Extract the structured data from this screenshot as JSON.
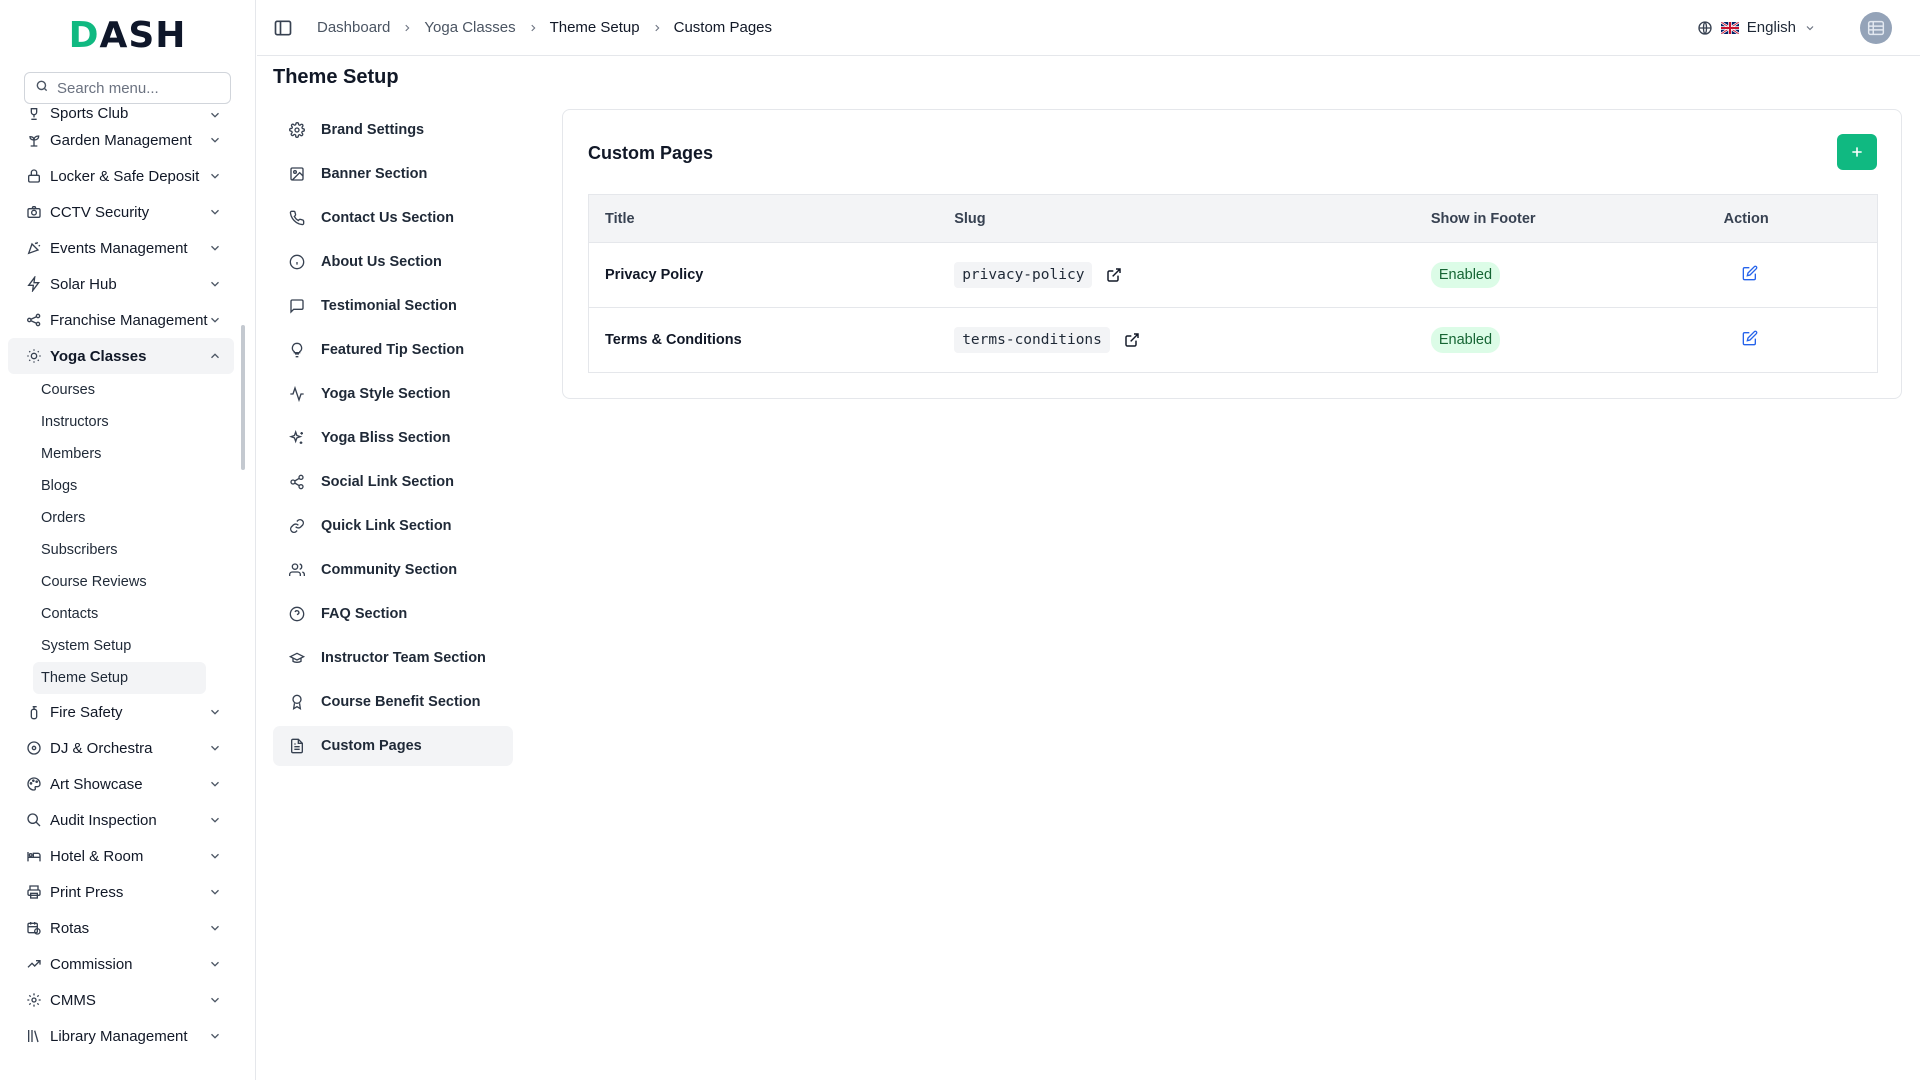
{
  "brand": {
    "logo_main": "ASH",
    "logo_accent": "D"
  },
  "search": {
    "placeholder": "Search menu..."
  },
  "sidebar": {
    "items": [
      {
        "label": "Sports Club",
        "icon": "trophy-icon"
      },
      {
        "label": "Garden Management",
        "icon": "plant-icon"
      },
      {
        "label": "Locker & Safe Deposit",
        "icon": "lock-icon"
      },
      {
        "label": "CCTV Security",
        "icon": "camera-icon"
      },
      {
        "label": "Events Management",
        "icon": "party-icon"
      },
      {
        "label": "Solar Hub",
        "icon": "bolt-icon"
      },
      {
        "label": "Franchise Management",
        "icon": "network-icon"
      },
      {
        "label": "Yoga Classes",
        "icon": "sun-icon"
      }
    ],
    "yoga_sub": [
      "Courses",
      "Instructors",
      "Members",
      "Blogs",
      "Orders",
      "Subscribers",
      "Course Reviews",
      "Contacts",
      "System Setup",
      "Theme Setup"
    ],
    "items_after": [
      {
        "label": "Fire Safety",
        "icon": "extinguisher-icon"
      },
      {
        "label": "DJ & Orchestra",
        "icon": "disc-icon"
      },
      {
        "label": "Art Showcase",
        "icon": "palette-icon"
      },
      {
        "label": "Audit Inspection",
        "icon": "search-doc-icon"
      },
      {
        "label": "Hotel & Room",
        "icon": "bed-icon"
      },
      {
        "label": "Print Press",
        "icon": "printer-icon"
      },
      {
        "label": "Rotas",
        "icon": "calendar-clock-icon"
      },
      {
        "label": "Commission",
        "icon": "trend-icon"
      },
      {
        "label": "CMMS",
        "icon": "cog-icon"
      },
      {
        "label": "Library Management",
        "icon": "books-icon"
      }
    ]
  },
  "topbar": {
    "breadcrumbs": [
      "Dashboard",
      "Yoga Classes",
      "Theme Setup",
      "Custom Pages"
    ],
    "language": "English"
  },
  "page": {
    "title": "Theme Setup"
  },
  "settings_nav": [
    {
      "label": "Brand Settings",
      "icon": "gear-icon"
    },
    {
      "label": "Banner Section",
      "icon": "image-icon"
    },
    {
      "label": "Contact Us Section",
      "icon": "phone-icon"
    },
    {
      "label": "About Us Section",
      "icon": "info-icon"
    },
    {
      "label": "Testimonial Section",
      "icon": "message-icon"
    },
    {
      "label": "Featured Tip Section",
      "icon": "lightbulb-icon"
    },
    {
      "label": "Yoga Style Section",
      "icon": "activity-icon"
    },
    {
      "label": "Yoga Bliss Section",
      "icon": "sparkles-icon"
    },
    {
      "label": "Social Link Section",
      "icon": "share-icon"
    },
    {
      "label": "Quick Link Section",
      "icon": "link-icon"
    },
    {
      "label": "Community Section",
      "icon": "users-icon"
    },
    {
      "label": "FAQ Section",
      "icon": "help-circle-icon"
    },
    {
      "label": "Instructor Team Section",
      "icon": "graduation-cap-icon"
    },
    {
      "label": "Course Benefit Section",
      "icon": "award-icon"
    },
    {
      "label": "Custom Pages",
      "icon": "file-text-icon"
    }
  ],
  "custom_pages": {
    "title": "Custom Pages",
    "columns": [
      "Title",
      "Slug",
      "Show in Footer",
      "Action"
    ],
    "rows": [
      {
        "title": "Privacy Policy",
        "slug": "privacy-policy",
        "status": "Enabled"
      },
      {
        "title": "Terms & Conditions",
        "slug": "terms-conditions",
        "status": "Enabled"
      }
    ]
  },
  "colors": {
    "accent": "#10b981",
    "badge_bg": "#dcfce7",
    "badge_text": "#166534",
    "edit": "#2563eb"
  }
}
